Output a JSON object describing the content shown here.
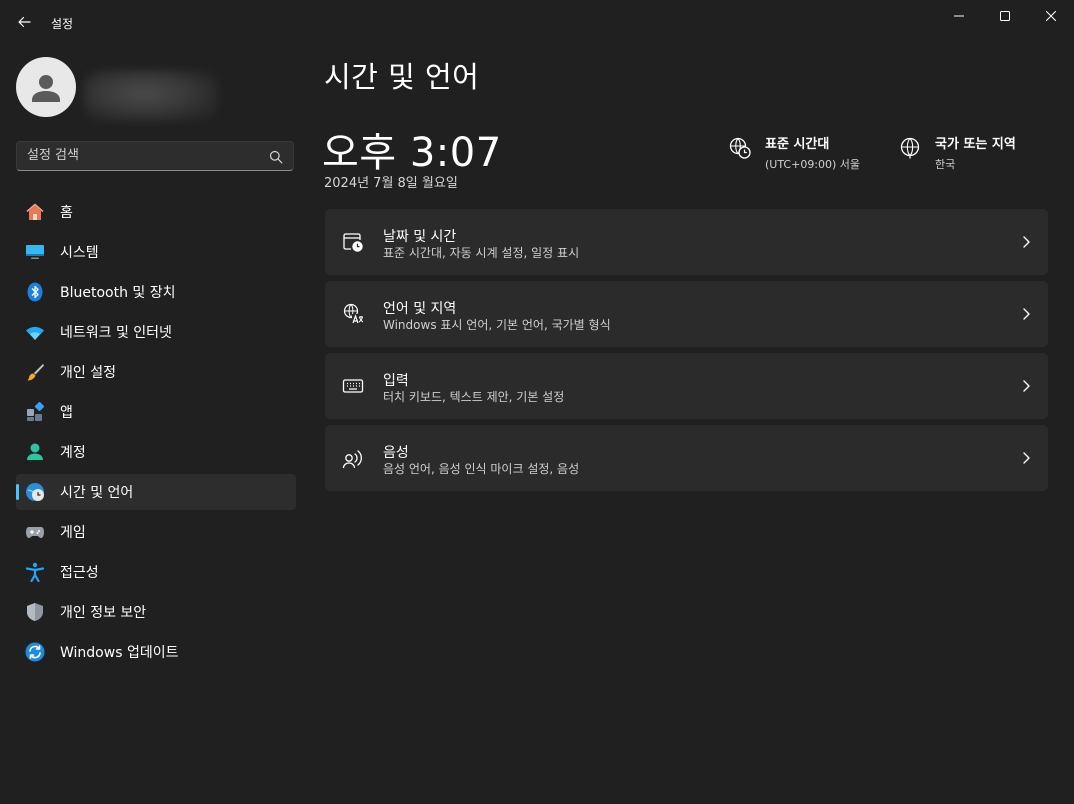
{
  "window": {
    "title": "설정"
  },
  "search": {
    "placeholder": "설정 검색"
  },
  "sidebar": {
    "items": [
      {
        "label": "홈",
        "icon": "home-icon"
      },
      {
        "label": "시스템",
        "icon": "system-monitor-icon"
      },
      {
        "label": "Bluetooth 및 장치",
        "icon": "bluetooth-icon"
      },
      {
        "label": "네트워크 및 인터넷",
        "icon": "wifi-icon"
      },
      {
        "label": "개인 설정",
        "icon": "paintbrush-icon"
      },
      {
        "label": "앱",
        "icon": "apps-icon"
      },
      {
        "label": "계정",
        "icon": "account-icon"
      },
      {
        "label": "시간 및 언어",
        "icon": "time-language-icon",
        "active": true
      },
      {
        "label": "게임",
        "icon": "gamepad-icon"
      },
      {
        "label": "접근성",
        "icon": "accessibility-icon"
      },
      {
        "label": "개인 정보 보안",
        "icon": "shield-icon"
      },
      {
        "label": "Windows 업데이트",
        "icon": "update-icon"
      }
    ]
  },
  "main": {
    "title": "시간 및 언어",
    "clock": "오후 3:07",
    "date": "2024년 7월 8일 월요일",
    "timezone": {
      "title": "표준 시간대",
      "value": "(UTC+09:00) 서울"
    },
    "region": {
      "title": "국가 또는 지역",
      "value": "한국"
    },
    "cards": [
      {
        "title": "날짜 및 시간",
        "subtitle": "표준 시간대, 자동 시계 설정, 일정 표시",
        "icon": "calendar-clock-icon"
      },
      {
        "title": "언어 및 지역",
        "subtitle": "Windows 표시 언어, 기본 언어, 국가별 형식",
        "icon": "language-icon"
      },
      {
        "title": "입력",
        "subtitle": "터치 키보드, 텍스트 제안, 기본 설정",
        "icon": "keyboard-icon"
      },
      {
        "title": "음성",
        "subtitle": "음성 언어, 음성 인식 마이크 설정, 음성",
        "icon": "speech-icon"
      }
    ]
  },
  "colors": {
    "accent": "#4cc2ff",
    "background": "#202020",
    "card": "#2b2b2b"
  }
}
